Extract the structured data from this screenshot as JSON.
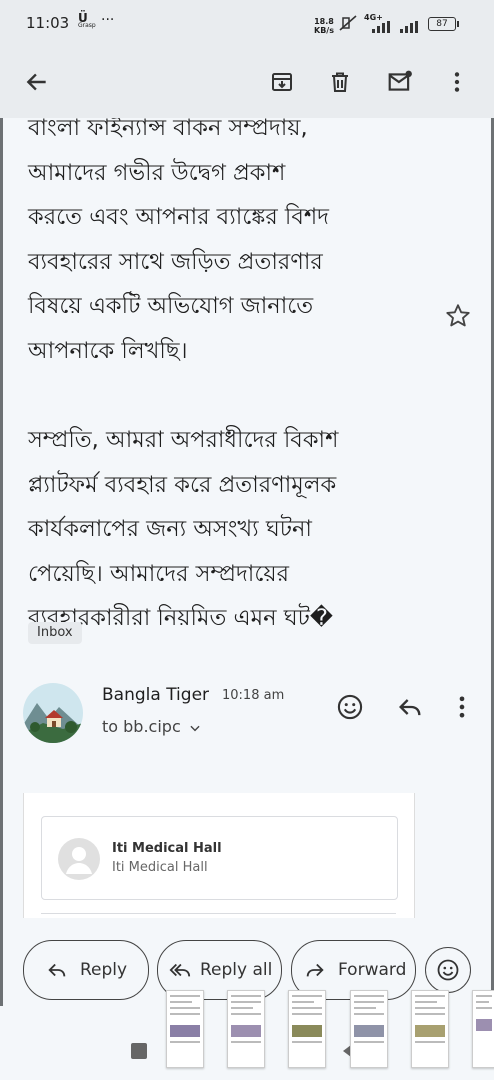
{
  "status_bar": {
    "time": "11:03",
    "carrier": "Ü",
    "carrier_sub": "Grasp",
    "overflow": "···",
    "net_speed": "18.8",
    "net_unit": "KB/s",
    "network": "4G+",
    "battery": "87"
  },
  "email": {
    "body_lines_1": [
      "বাংলা ফাইন্যান্স বাকন সম্প্রদায়,",
      "আমাদের গভীর উদ্বেগ প্রকাশ",
      "করতে এবং আপনার ব্যাঙ্কের বিশদ",
      "ব্যবহারের সাথে জড়িত প্রতারণার",
      "বিষয়ে একটি অভিযোগ জানাতে",
      "আপনাকে লিখছি।"
    ],
    "body_lines_2": [
      "সম্প্রতি, আমরা অপরাধীদের বিকাশ",
      "প্ল্যাটফর্ম ব্যবহার করে প্রতারণামূলক",
      "কার্যকলাপের জন্য অসংখ্য ঘটনা",
      "পেয়েছি। আমাদের সম্প্রদায়ের",
      "ব্যবহারকারীরা নিয়মিত এমন ঘট�"
    ],
    "label": "Inbox",
    "sender": "Bangla Tiger",
    "time": "10:18 am",
    "to": "to bb.cipc"
  },
  "embedded_card": {
    "name": "Iti Medical Hall",
    "subtitle": "Iti Medical Hall"
  },
  "actions": {
    "reply": "Reply",
    "reply_all": "Reply all",
    "forward": "Forward"
  },
  "icons": {
    "toolbar": [
      "back-arrow-icon",
      "archive-icon",
      "delete-icon",
      "mark-unread-icon",
      "more-vert-icon"
    ],
    "header": [
      "emoji-icon",
      "reply-icon",
      "more-vert-icon"
    ]
  },
  "colors": {
    "background": "#f4f7fa",
    "toolbar": "#e9ecef",
    "text": "#1f1f1f"
  }
}
